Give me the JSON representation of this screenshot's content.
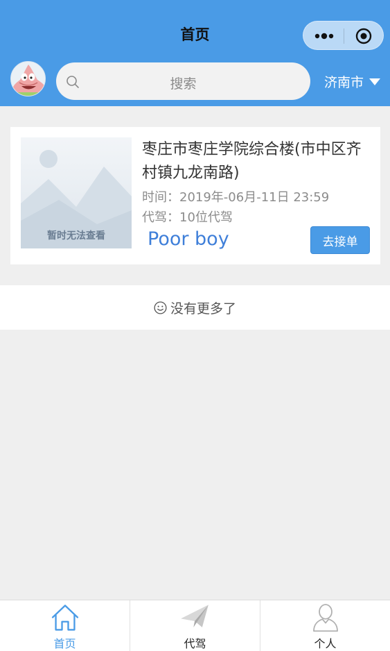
{
  "header": {
    "title": "首页",
    "capsule": {
      "more_icon": "more-dots-icon",
      "target_icon": "target-icon"
    },
    "search": {
      "placeholder": "搜索",
      "icon": "search-icon"
    },
    "city": "济南市",
    "avatar_icon": "patrick-star-avatar"
  },
  "orders": [
    {
      "image_placeholder": "暂时无法查看",
      "title": "枣庄市枣庄学院综合楼(市中区齐村镇九龙南路)",
      "time_label": "时间：",
      "time": "2019年-06月-11日 23:59",
      "drivers_label": "代驾：",
      "drivers": "10位代驾",
      "user": "Poor boy",
      "action": "去接单"
    }
  ],
  "no_more": {
    "icon": "smile-icon",
    "text": "没有更多了"
  },
  "tabbar": [
    {
      "label": "首页",
      "icon": "home-icon",
      "active": true
    },
    {
      "label": "代驾",
      "icon": "paper-plane-icon",
      "active": false
    },
    {
      "label": "个人",
      "icon": "person-icon",
      "active": false
    }
  ],
  "colors": {
    "primary": "#4a9be6",
    "user_name": "#3f7fd9",
    "background": "#efefef"
  }
}
